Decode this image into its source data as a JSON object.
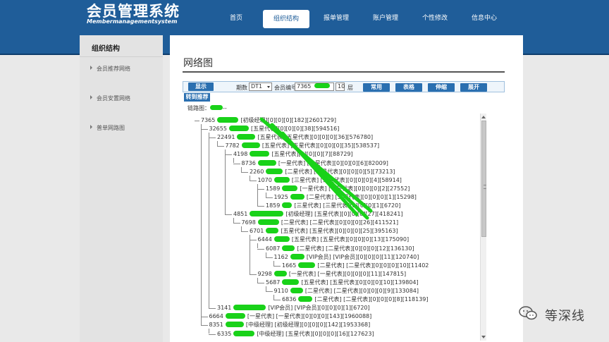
{
  "app": {
    "logo_title": "会员管理系统",
    "logo_subtitle": "Membermanagementsystem"
  },
  "nav": {
    "items": [
      "首页",
      "组织结构",
      "报单管理",
      "账户管理",
      "个性修改",
      "信息中心"
    ],
    "active": "组织结构"
  },
  "sidebar": {
    "title": "组织结构",
    "items": [
      "会员推荐网络",
      "会员安置网络",
      "普单网路图"
    ]
  },
  "main": {
    "title": "网络图",
    "toolbar": {
      "show_button": "显示",
      "period_label": "期数",
      "period_value": "DT1",
      "member_no_label": "会员编号",
      "member_no_value": "7365",
      "layers_value": "10",
      "layers_label": "层",
      "common_button": "常用",
      "table_button": "表格",
      "collapse_button": "伸缩",
      "expand_button": "展开"
    },
    "switch_button": "转到推荐",
    "chain_label": "链路图：",
    "chain_suffix": "--"
  },
  "tree": [
    {
      "text": "7365",
      "info": "[初级经理][0][0][0][182][2601729]"
    },
    {
      "text": "32655",
      "info": "[五星代表][0][0][0][38][594516]"
    },
    {
      "text": "22491",
      "info": "[五星代表][五星代表][0][0][0][36][576780]"
    },
    {
      "text": "7782",
      "info": "[五星代表] [五星代表][0][0][0][35][538537]"
    },
    {
      "text": "4198",
      "info": "[五星代表][0][0][0][7][88729]"
    },
    {
      "text": "8736",
      "info": "[一星代表] [一星代表][0][0][0][6][82009]"
    },
    {
      "text": "2260",
      "info": "[二星代表] [二星代表][0][0][0][5][73213]"
    },
    {
      "text": "1070",
      "info": "[三星代表] [三星代表][0][0][0][4][58914]"
    },
    {
      "text": "1589",
      "info": "[一星代表] [一星代表][0][0][0][2][27552]"
    },
    {
      "text": "1925",
      "info": "[二星代表] [二星代表][0][0][0][1][15298]"
    },
    {
      "text": "1859",
      "info": "[三星代表] [三星代表][0][0][0][1][6720]"
    },
    {
      "text": "4851",
      "info": "[初级经理] [五星代表][0][0][0][27][418241]"
    },
    {
      "text": "7698",
      "info": "[二星代表] [二星代表][0][0][0][26][411521]"
    },
    {
      "text": "6701",
      "info": "[五星代表] [五星代表][0][0][0][25][395163]"
    },
    {
      "text": "6444",
      "info": "[五星代表] [五星代表][0][0][0][13][175090]"
    },
    {
      "text": "6087",
      "info": "[二星代表] [二星代表][0][0][0][12][136130]"
    },
    {
      "text": "1162",
      "info": "[VIP会员] [VIP会员][0][0][0][11][120740]"
    },
    {
      "text": "1665",
      "info": "[二星代表] [二星代表][0][0][0][10][11402"
    },
    {
      "text": "9298",
      "info": "[一星代表] [一星代表][0][0][0][11][147815]"
    },
    {
      "text": "5687",
      "info": "[五星代表] [五星代表][0][0][0][10][139804]"
    },
    {
      "text": "9110",
      "info": "[二星代表] [二星代表][0][0][0][9][133084]"
    },
    {
      "text": "6836",
      "info": "[二星代表] [二星代表][0][0][0][8][118139]"
    },
    {
      "text": "3141",
      "info": "[VIP会员] [VIP会员][0][0][0][1][6720]"
    },
    {
      "text": "6664",
      "info": "[一星代表] [一星代表][0][0][0][143][1960088]"
    },
    {
      "text": "8351",
      "info": "[中级经理] [初级经理][0][0][0][142][1953368]"
    },
    {
      "text": "6335",
      "info": "[中级经理] [五星代表][0][0][0][16][127623]"
    }
  ],
  "watermark": {
    "text": "等深线"
  },
  "colors": {
    "header_bg": "#1f5d99",
    "button_bg": "#2a6fb0",
    "redaction_green": "#19d219"
  }
}
